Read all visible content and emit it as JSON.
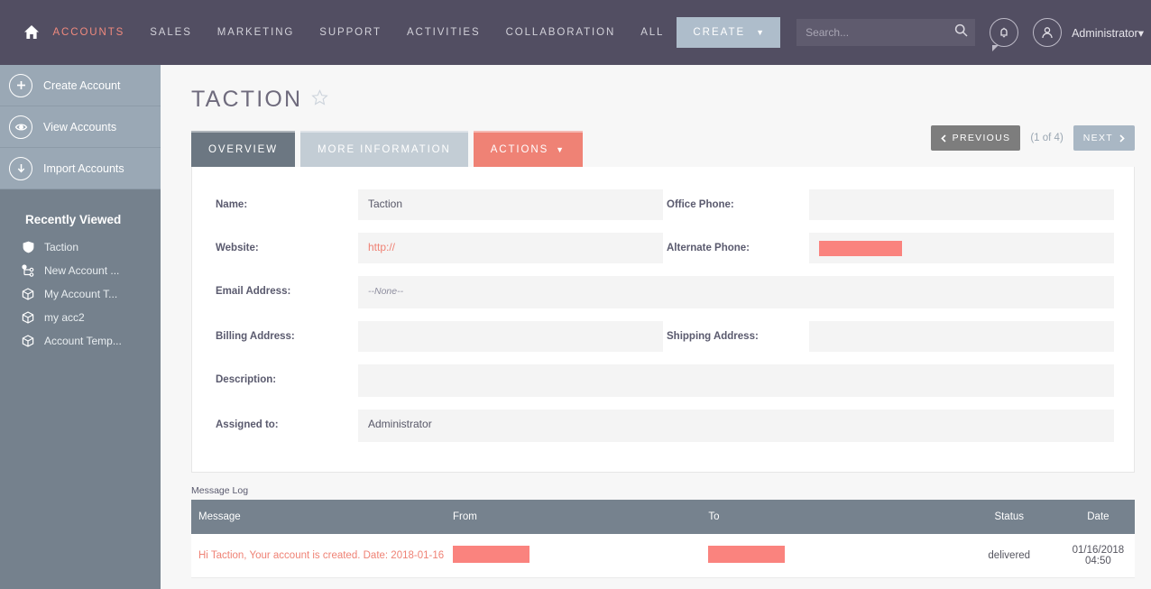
{
  "header": {
    "home_icon": "home-icon",
    "nav": [
      {
        "label": "ACCOUNTS",
        "active": true
      },
      {
        "label": "SALES",
        "active": false
      },
      {
        "label": "MARKETING",
        "active": false
      },
      {
        "label": "SUPPORT",
        "active": false
      },
      {
        "label": "ACTIVITIES",
        "active": false
      },
      {
        "label": "COLLABORATION",
        "active": false
      },
      {
        "label": "ALL",
        "active": false
      }
    ],
    "create_label": "CREATE",
    "create_caret": "▼",
    "search": {
      "value": "",
      "placeholder": "Search..."
    },
    "notifications_icon": "bell-icon",
    "avatar_icon": "user-icon",
    "user_label": "Administrator",
    "user_caret": "▾",
    "accent_color": "#f08a7e",
    "background_color": "#524e62"
  },
  "sidebar": {
    "actions": [
      {
        "label": "Create Account",
        "icon": "plus-circle-icon"
      },
      {
        "label": "View Accounts",
        "icon": "eye-circle-icon"
      },
      {
        "label": "Import Accounts",
        "icon": "download-circle-icon"
      }
    ],
    "recent_title": "Recently Viewed",
    "recent_items": [
      {
        "label": "Taction",
        "icon": "shield-icon"
      },
      {
        "label": "New Account ...",
        "icon": "node-icon"
      },
      {
        "label": "My Account T...",
        "icon": "cube-icon"
      },
      {
        "label": "my acc2",
        "icon": "cube-icon"
      },
      {
        "label": "Account Temp...",
        "icon": "cube-icon"
      }
    ],
    "collapse_icon": "chevron-left-icon",
    "background_color": "#75818d"
  },
  "main": {
    "title": "TACTION",
    "favorite_icon": "star-outline-icon",
    "tabs": [
      {
        "label": "OVERVIEW",
        "state": "active"
      },
      {
        "label": "MORE INFORMATION",
        "state": "passive"
      },
      {
        "label": "ACTIONS",
        "state": "actions",
        "caret": "▼"
      }
    ],
    "pager": {
      "previous_label": "PREVIOUS",
      "previous_icon": "chevron-left-icon",
      "count_label": "(1 of 4)",
      "next_label": "NEXT",
      "next_icon": "chevron-right-icon"
    },
    "fields": {
      "name_label": "Name:",
      "name_value": "Taction",
      "office_phone_label": "Office Phone:",
      "office_phone_value": "",
      "website_label": "Website:",
      "website_value": "http://",
      "alternate_phone_label": "Alternate Phone:",
      "alternate_phone_value": "",
      "email_label": "Email Address:",
      "email_value": "--None--",
      "billing_label": "Billing Address:",
      "billing_value": "",
      "shipping_label": "Shipping Address:",
      "shipping_value": "",
      "description_label": "Description:",
      "description_value": "",
      "assigned_label": "Assigned to:",
      "assigned_value": "Administrator"
    },
    "message_log": {
      "section_label": "Message Log",
      "columns": [
        "Message",
        "From",
        "To",
        "Status",
        "Date"
      ],
      "rows": [
        {
          "message": "Hi Taction, Your account is created. Date: 2018-01-16",
          "from": "",
          "to": "",
          "status": "delivered",
          "date_line1": "01/16/2018",
          "date_line2": "04:50"
        }
      ]
    },
    "redaction_color": "#fa837e"
  }
}
